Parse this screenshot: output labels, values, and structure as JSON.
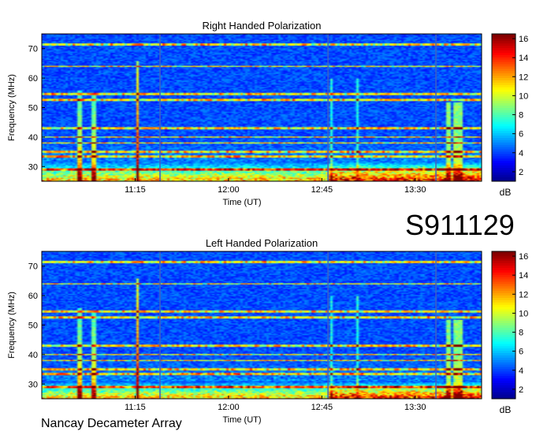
{
  "observation_id": "S911129",
  "instrument": "Nancay Decameter Array",
  "colors": {
    "colormap": [
      "#00008f",
      "#0000ff",
      "#0080ff",
      "#00ffff",
      "#80ff80",
      "#ffff00",
      "#ff8000",
      "#ff0000",
      "#800000"
    ],
    "background": "#ffffff"
  },
  "chart_data": [
    {
      "type": "heatmap",
      "title": "Right Handed Polarization",
      "xlabel": "Time (UT)",
      "ylabel": "Frequency (MHz)",
      "x_ticks": [
        "11:15",
        "12:00",
        "12:45",
        "13:30"
      ],
      "x_tick_minutes": [
        675,
        720,
        765,
        810
      ],
      "xlim_minutes": [
        630,
        842
      ],
      "y_ticks": [
        30,
        40,
        50,
        60,
        70
      ],
      "ylim": [
        25,
        75
      ],
      "colorbar": {
        "label": "dB",
        "ticks": [
          2,
          4,
          6,
          8,
          10,
          12,
          14,
          16
        ],
        "range": [
          1,
          16.5
        ]
      },
      "features": {
        "vertical_bursts_minutes": [
          648,
          655,
          676
        ],
        "bright_band_mhz": [
          25,
          32
        ],
        "interference_lines_mhz": [
          29,
          33.5,
          35,
          38,
          40,
          43,
          52.5,
          54.5,
          64,
          71.5
        ],
        "gap_columns_minutes": [
          687,
          768,
          820
        ]
      }
    },
    {
      "type": "heatmap",
      "title": "Left Handed Polarization",
      "xlabel": "Time (UT)",
      "ylabel": "Frequency (MHz)",
      "x_ticks": [
        "11:15",
        "12:00",
        "12:45",
        "13:30"
      ],
      "x_tick_minutes": [
        675,
        720,
        765,
        810
      ],
      "xlim_minutes": [
        630,
        842
      ],
      "y_ticks": [
        30,
        40,
        50,
        60,
        70
      ],
      "ylim": [
        25,
        75
      ],
      "colorbar": {
        "label": "dB",
        "ticks": [
          2,
          4,
          6,
          8,
          10,
          12,
          14,
          16
        ],
        "range": [
          1,
          16.5
        ]
      },
      "features": {
        "vertical_bursts_minutes": [
          648,
          655,
          676
        ],
        "bright_band_mhz": [
          25,
          31
        ],
        "interference_lines_mhz": [
          29,
          33.5,
          35,
          38,
          40,
          43,
          52.5,
          54.5,
          64,
          71.5
        ],
        "gap_columns_minutes": [
          687,
          768,
          820
        ]
      }
    }
  ]
}
